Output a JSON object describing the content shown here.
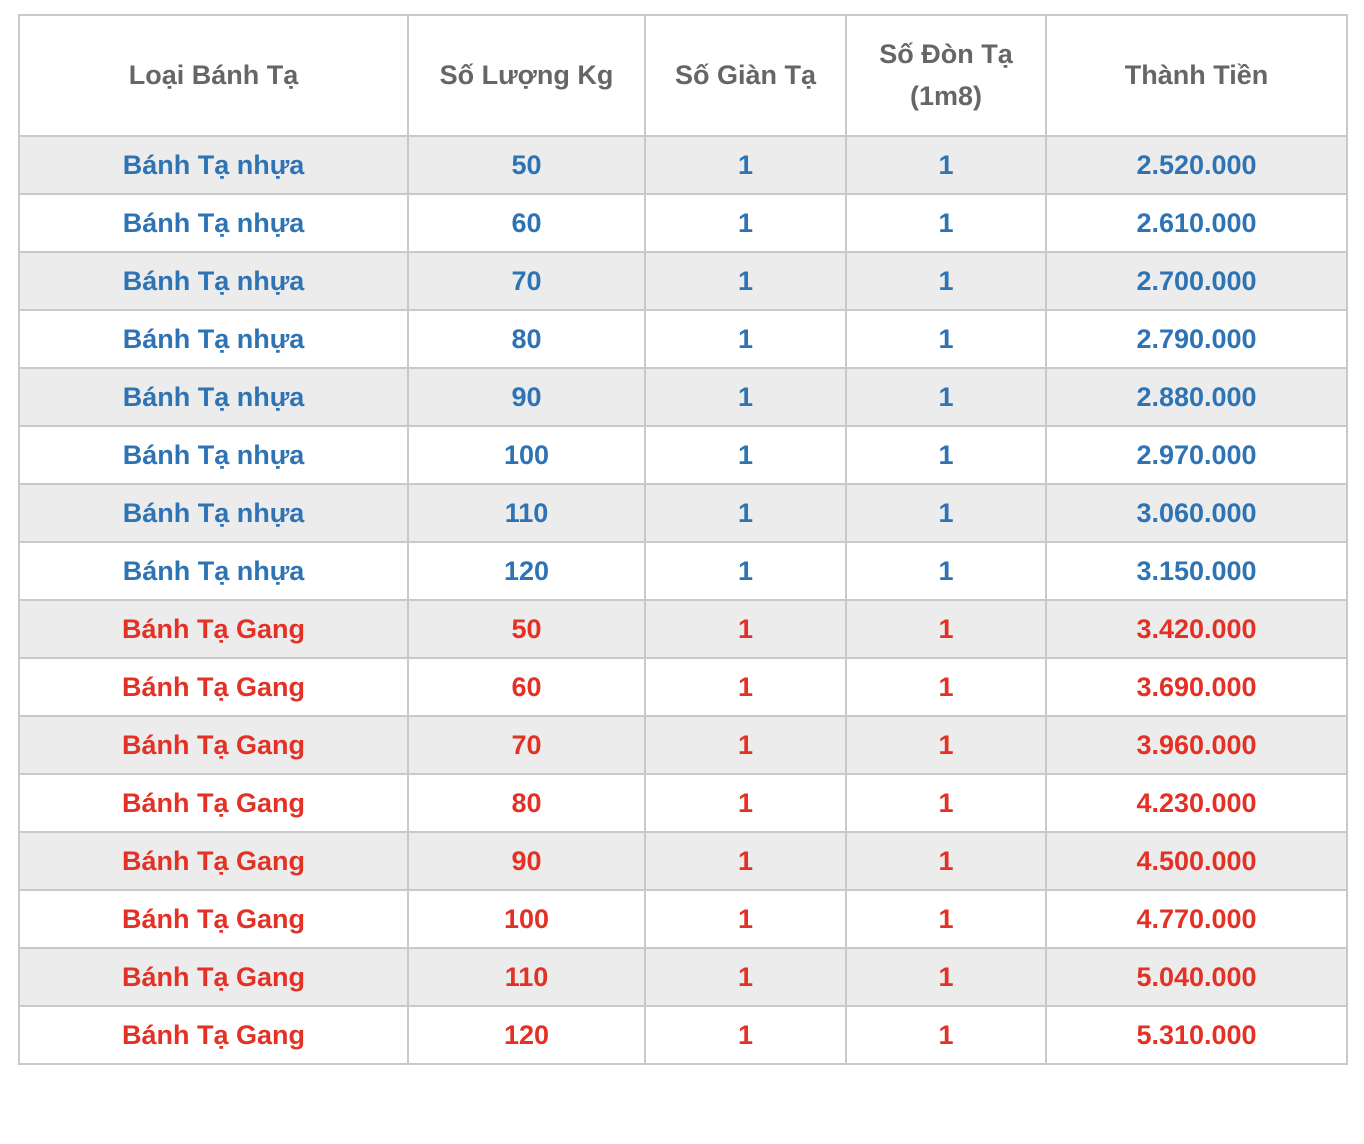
{
  "colors": {
    "plastic_row_text": "#2E74B5",
    "cast_iron_row_text": "#E43125",
    "header_text": "#666666",
    "row_stripe_bg": "#ECECEC",
    "row_bg": "#FFFFFF",
    "border": "#C9C9C9"
  },
  "chart_data": {
    "type": "table",
    "columns": [
      "Loại Bánh Tạ",
      "Số Lượng Kg",
      "Số Giàn Tạ",
      "Số Đòn Tạ (1m8)",
      "Thành Tiền"
    ],
    "rows": [
      {
        "variant": "nhua",
        "type": "Bánh Tạ nhựa",
        "kg": "50",
        "racks": "1",
        "bars": "1",
        "price": "2.520.000"
      },
      {
        "variant": "nhua",
        "type": "Bánh Tạ nhựa",
        "kg": "60",
        "racks": "1",
        "bars": "1",
        "price": "2.610.000"
      },
      {
        "variant": "nhua",
        "type": "Bánh Tạ nhựa",
        "kg": "70",
        "racks": "1",
        "bars": "1",
        "price": "2.700.000"
      },
      {
        "variant": "nhua",
        "type": "Bánh Tạ nhựa",
        "kg": "80",
        "racks": "1",
        "bars": "1",
        "price": "2.790.000"
      },
      {
        "variant": "nhua",
        "type": "Bánh Tạ nhựa",
        "kg": "90",
        "racks": "1",
        "bars": "1",
        "price": "2.880.000"
      },
      {
        "variant": "nhua",
        "type": "Bánh Tạ nhựa",
        "kg": "100",
        "racks": "1",
        "bars": "1",
        "price": "2.970.000"
      },
      {
        "variant": "nhua",
        "type": "Bánh Tạ nhựa",
        "kg": "110",
        "racks": "1",
        "bars": "1",
        "price": "3.060.000"
      },
      {
        "variant": "nhua",
        "type": "Bánh Tạ nhựa",
        "kg": "120",
        "racks": "1",
        "bars": "1",
        "price": "3.150.000"
      },
      {
        "variant": "gang",
        "type": "Bánh Tạ Gang",
        "kg": "50",
        "racks": "1",
        "bars": "1",
        "price": "3.420.000"
      },
      {
        "variant": "gang",
        "type": "Bánh Tạ Gang",
        "kg": "60",
        "racks": "1",
        "bars": "1",
        "price": "3.690.000"
      },
      {
        "variant": "gang",
        "type": "Bánh Tạ Gang",
        "kg": "70",
        "racks": "1",
        "bars": "1",
        "price": "3.960.000"
      },
      {
        "variant": "gang",
        "type": "Bánh Tạ Gang",
        "kg": "80",
        "racks": "1",
        "bars": "1",
        "price": "4.230.000"
      },
      {
        "variant": "gang",
        "type": "Bánh Tạ Gang",
        "kg": "90",
        "racks": "1",
        "bars": "1",
        "price": "4.500.000"
      },
      {
        "variant": "gang",
        "type": "Bánh Tạ Gang",
        "kg": "100",
        "racks": "1",
        "bars": "1",
        "price": "4.770.000"
      },
      {
        "variant": "gang",
        "type": "Bánh Tạ Gang",
        "kg": "110",
        "racks": "1",
        "bars": "1",
        "price": "5.040.000"
      },
      {
        "variant": "gang",
        "type": "Bánh Tạ Gang",
        "kg": "120",
        "racks": "1",
        "bars": "1",
        "price": "5.310.000"
      }
    ]
  }
}
